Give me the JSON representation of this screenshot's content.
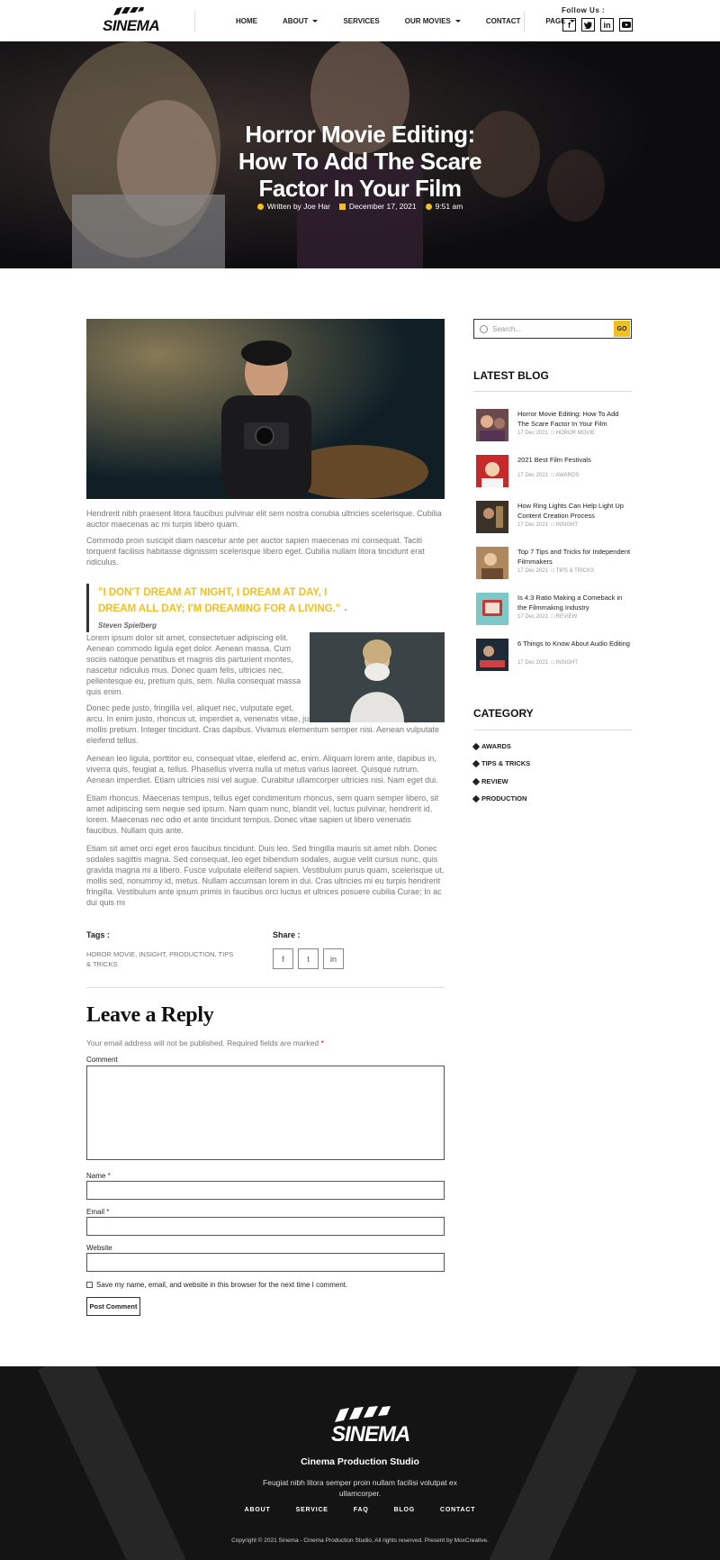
{
  "header": {
    "logo_text": "SINEMA",
    "nav": [
      "HOME",
      "ABOUT",
      "SERVICES",
      "OUR MOVIES",
      "CONTACT",
      "PAGE"
    ],
    "follow_label": "Follow Us :",
    "social_icons": [
      "facebook-icon",
      "twitter-icon",
      "linkedin-icon",
      "youtube-icon"
    ]
  },
  "hero": {
    "title": "Horror Movie Editing: How To Add The Scare Factor In Your Film",
    "author": "Written by Joe Har",
    "date": "December 17, 2021",
    "time": "9:51 am"
  },
  "article": {
    "p1": "Hendrerit nibh praesent litora faucibus pulvinar elit sem nostra conubia ultricies scelerisque. Cubilia auctor maecenas ac mi turpis libero quam.",
    "p2": "Commodo proin suscipit diam nascetur ante per auctor sapien maecenas mi consequat. Taciti torquent facilisis habitasse dignissim scelerisque libero eget. Cubilia nullam litora tincidunt erat ridiculus.",
    "quote": "\"I DON'T DREAM AT NIGHT, I DREAM AT DAY, I DREAM ALL DAY; I'M DREAMING FOR A LIVING.\"",
    "quote_author": "- Steven Spielberg",
    "p3": "Lorem ipsum dolor sit amet, consectetuer adipiscing elit. Aenean commodo ligula eget dolor. Aenean massa. Cum sociis natoque penatibus et magnis dis parturient montes, nascetur ridiculus mus. Donec quam felis, ultricies nec, pellentesque eu, pretium quis, sem. Nulla consequat massa quis enim.",
    "p4a": "Donec pede justo, fringilla vel, aliquet nec, vulputate eget,",
    "p4b": "arcu. In enim justo, rhoncus ut, imperdiet a, venenatis vitae, justo. Nullam dictum felis eu pede mollis pretium. Integer tincidunt. Cras dapibus. Vivamus elementum semper nisi. Aenean vulputate eleifend tellus.",
    "p5": "Aenean leo ligula, porttitor eu, consequat vitae, eleifend ac, enim. Aliquam lorem ante, dapibus in, viverra quis, feugiat a, tellus. Phasellus viverra nulla ut metus varius laoreet. Quisque rutrum. Aenean imperdiet. Etiam ultricies nisi vel augue. Curabitur ullamcorper ultricies nisi. Nam eget dui.",
    "p6": "Etiam rhoncus. Maecenas tempus, tellus eget condimentum rhoncus, sem quam semper libero, sit amet adipiscing sem neque sed ipsum. Nam quam nunc, blandit vel, luctus pulvinar, hendrerit id, lorem. Maecenas nec odio et ante tincidunt tempus. Donec vitae sapien ut libero venenatis faucibus. Nullam quis ante.",
    "p7": "Etiam sit amet orci eget eros faucibus tincidunt. Duis leo. Sed fringilla mauris sit amet nibh. Donec sodales sagittis magna. Sed consequat, leo eget bibendum sodales, augue velit cursus nunc, quis gravida magna mi a libero. Fusce vulputate eleifend sapien. Vestibulum purus quam, scelerisque ut, mollis sed, nonummy id, metus. Nullam accumsan lorem in dui. Cras ultricies mi eu turpis hendrerit fringilla. Vestibulum ante ipsum primis in faucibus orci luctus et ultrices posuere cubilia Curae; In ac dui quis mi",
    "tags_label": "Tags :",
    "tags": "HOROR MOVIE, INSIGHT, PRODUCTION, TIPS & TRICKS",
    "share_label": "Share :",
    "share_icons": [
      "facebook-icon",
      "twitter-icon",
      "linkedin-icon"
    ]
  },
  "reply": {
    "title": "Leave a Reply",
    "note": "Your email address will not be published. Required fields are marked",
    "required_mark": "*",
    "comment_label": "Comment",
    "name_label": "Name",
    "email_label": "Email",
    "website_label": "Website",
    "save_label": "Save my name, email, and website in this browser for the next time I comment.",
    "submit": "Post Comment"
  },
  "sidebar": {
    "search_placeholder": "Search...",
    "search_button": "GO",
    "latest_heading": "LATEST BLOG",
    "posts": [
      {
        "title": "Horror Movie Editing: How To Add The Scare Factor In Your Film",
        "date": "17 Dec 2021",
        "category": "HOROR MOVIE"
      },
      {
        "title": "2021 Best Film Festivals",
        "date": "17 Dec 2021",
        "category": "AWARDS"
      },
      {
        "title": "How Ring Lights Can Help Light Up Content Creation Process",
        "date": "17 Dec 2021",
        "category": "INSIGHT"
      },
      {
        "title": "Top 7 Tips and Tricks for Independent Filmmakers",
        "date": "17 Dec 2021",
        "category": "TIPS & TRICKS"
      },
      {
        "title": "Is 4:3 Ratio Making a Comeback in the Filmmaking Industry",
        "date": "17 Dec 2021",
        "category": "REVIEW"
      },
      {
        "title": "6 Things to Know About Audio Editing",
        "date": "17 Dec 2021",
        "category": "INSIGHT"
      }
    ],
    "category_heading": "CATEGORY",
    "categories": [
      "AWARDS",
      "TIPS & TRICKS",
      "REVIEW",
      "PRODUCTION"
    ]
  },
  "footer": {
    "logo_text": "SINEMA",
    "title": "Cinema Production Studio",
    "text": "Feugiat nibh litora semper proin nullam facilisi volutpat ex ullamcorper.",
    "nav": [
      "ABOUT",
      "SERVICE",
      "FAQ",
      "BLOG",
      "CONTACT"
    ],
    "copyright": "Copyright © 2021 Sinema - Cinema Production Studio, All rights reserved. Present by MoxCreative."
  },
  "colors": {
    "accent": "#f2c01e",
    "dark": "#141414",
    "text": "#777777"
  }
}
